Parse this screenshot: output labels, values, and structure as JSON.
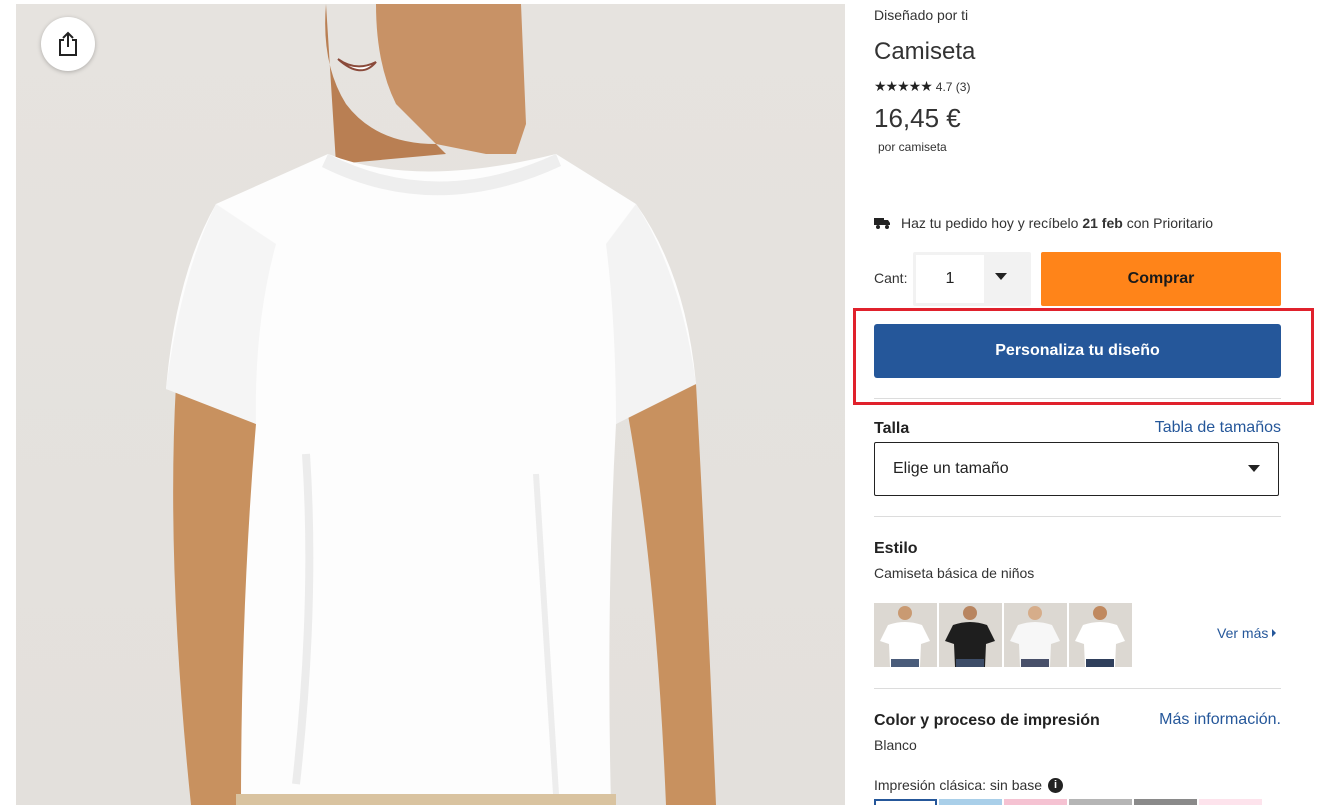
{
  "product": {
    "designed_by": "Diseñado por ti",
    "title": "Camiseta",
    "rating_stars": "★★★★★",
    "rating_text": "4.7 (3)",
    "rating_value": 4.7,
    "price": "16,45 €",
    "per_unit": "por camiseta"
  },
  "delivery": {
    "prefix": "Haz tu pedido hoy y recíbelo",
    "date": "21 feb",
    "suffix": "con Prioritario"
  },
  "purchase": {
    "qty_label": "Cant:",
    "qty_value": "1",
    "buy_label": "Comprar",
    "customize_label": "Personaliza tu diseño"
  },
  "size": {
    "label": "Talla",
    "chart_link": "Tabla de tamaños",
    "select_value": "Elige un tamaño"
  },
  "style": {
    "label": "Estilo",
    "selected": "Camiseta básica de niños",
    "see_more": "Ver más",
    "thumbnails": [
      {
        "shirt": "#ffffff",
        "skin": "#c99a72"
      },
      {
        "shirt": "#1e1e1e",
        "skin": "#b88560"
      },
      {
        "shirt": "#f7f7f7",
        "skin": "#d6ad8a"
      },
      {
        "shirt": "#ffffff",
        "skin": "#c0895f"
      }
    ]
  },
  "color": {
    "label": "Color y proceso de impresión",
    "info_link": "Más información.",
    "selected": "Blanco",
    "print_label": "Impresión clásica: sin base",
    "info_icon": "i",
    "swatches": [
      "#ffffff",
      "#a9cfe9",
      "#f5c2d2",
      "#b5b5b5",
      "#8a8a8a",
      "#fde3ec"
    ]
  },
  "colors": {
    "accent_orange": "#ff8419",
    "accent_blue": "#25579a",
    "highlight_red": "#e0212c"
  }
}
